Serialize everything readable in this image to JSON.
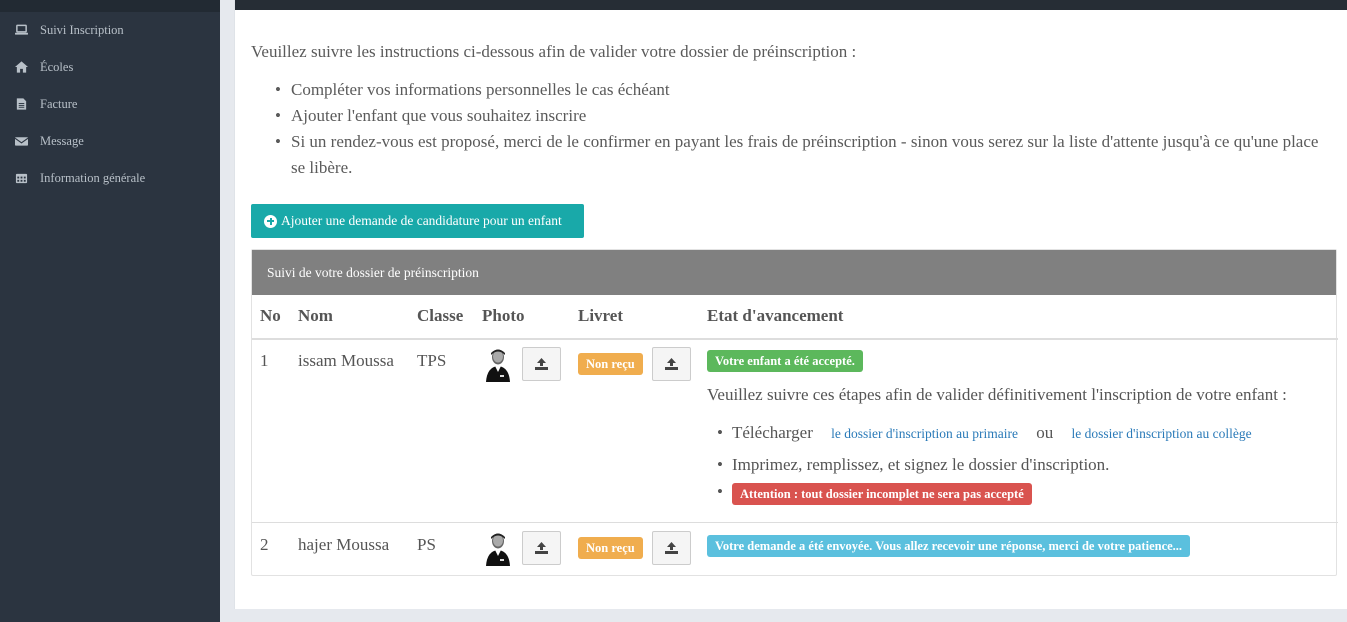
{
  "sidebar": {
    "items": [
      {
        "icon": "laptop-icon",
        "label": "Suivi Inscription"
      },
      {
        "icon": "home-icon",
        "label": "Écoles"
      },
      {
        "icon": "file-icon",
        "label": "Facture"
      },
      {
        "icon": "envelope-icon",
        "label": "Message"
      },
      {
        "icon": "calendar-icon",
        "label": "Information générale"
      }
    ]
  },
  "intro": {
    "text": "Veuillez suivre les instructions ci-dessous afin de valider votre dossier de préinscription :",
    "bullets": [
      "Compléter vos informations personnelles le cas échéant",
      "Ajouter l'enfant que vous souhaitez inscrire",
      "Si un rendez-vous est proposé, merci de le confirmer en payant les frais de préinscription - sinon vous serez sur la liste d'attente jusqu'à ce qu'une place se libère."
    ]
  },
  "add_button": "Ajouter une demande de candidature pour un enfant",
  "panel": {
    "title": "Suivi de votre dossier de préinscription",
    "columns": [
      "No",
      "Nom",
      "Classe",
      "Photo",
      "Livret",
      "Etat d'avancement"
    ],
    "rows": [
      {
        "no": "1",
        "nom": "issam Moussa",
        "classe": "TPS",
        "livret": "Non reçu",
        "status": "Votre enfant a été accepté.",
        "steps_title": "Veuillez suivre ces étapes afin de valider définitivement l'inscription de votre enfant :",
        "download_label": "Télécharger",
        "link_primaire": "le dossier d'inscription au primaire",
        "or": "ou",
        "link_college": "le dossier d'inscription au collège",
        "print_step": "Imprimez, remplissez, et signez le dossier d'inscription.",
        "warning": "Attention : tout dossier incomplet ne sera pas accepté"
      },
      {
        "no": "2",
        "nom": "hajer Moussa",
        "classe": "PS",
        "livret": "Non reçu",
        "status": "Votre demande a été envoyée. Vous allez recevoir une réponse, merci de votre patience..."
      }
    ]
  },
  "colors": {
    "sidebar_bg": "#2b3440",
    "accent_teal": "#19a9a9",
    "success": "#5cb85c",
    "warning": "#f0ad4e",
    "danger": "#d9534f",
    "info": "#5bc0de",
    "link": "#2a7ab8"
  }
}
